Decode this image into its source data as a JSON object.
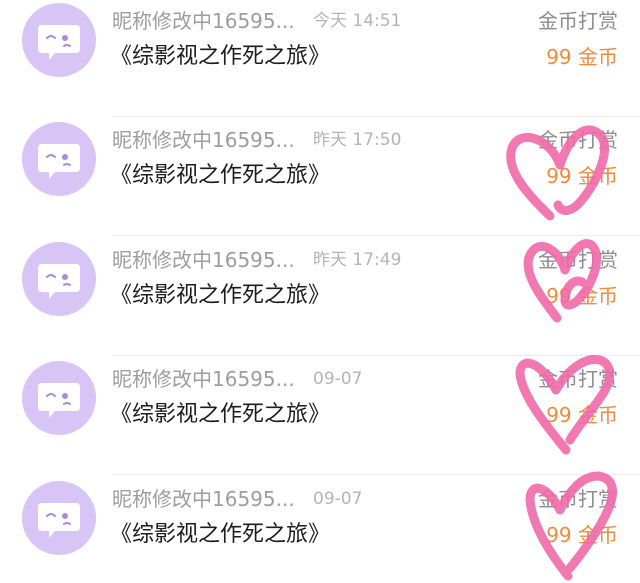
{
  "records": [
    {
      "nickname": "昵称修改中16595...",
      "time": "今天 14:51",
      "book": "《综影视之作死之旅》",
      "reward_label": "金币打赏",
      "reward_amount": "99 金币"
    },
    {
      "nickname": "昵称修改中16595...",
      "time": "昨天 17:50",
      "book": "《综影视之作死之旅》",
      "reward_label": "金币打赏",
      "reward_amount": "99 金币"
    },
    {
      "nickname": "昵称修改中16595...",
      "time": "昨天 17:49",
      "book": "《综影视之作死之旅》",
      "reward_label": "金币打赏",
      "reward_amount": "99 金币"
    },
    {
      "nickname": "昵称修改中16595...",
      "time": "09-07",
      "book": "《综影视之作死之旅》",
      "reward_label": "金币打赏",
      "reward_amount": "99 金币"
    },
    {
      "nickname": "昵称修改中16595...",
      "time": "09-07",
      "book": "《综影视之作死之旅》",
      "reward_label": "金币打赏",
      "reward_amount": "99 金币"
    }
  ],
  "colors": {
    "avatar_bg": "#d8c4f5",
    "reward_amount": "#f08a3c",
    "heart_annotation": "#f06aa8"
  },
  "icons": {
    "avatar": "chat-bubble-face-icon",
    "annotation": "heart-scribble-icon"
  }
}
